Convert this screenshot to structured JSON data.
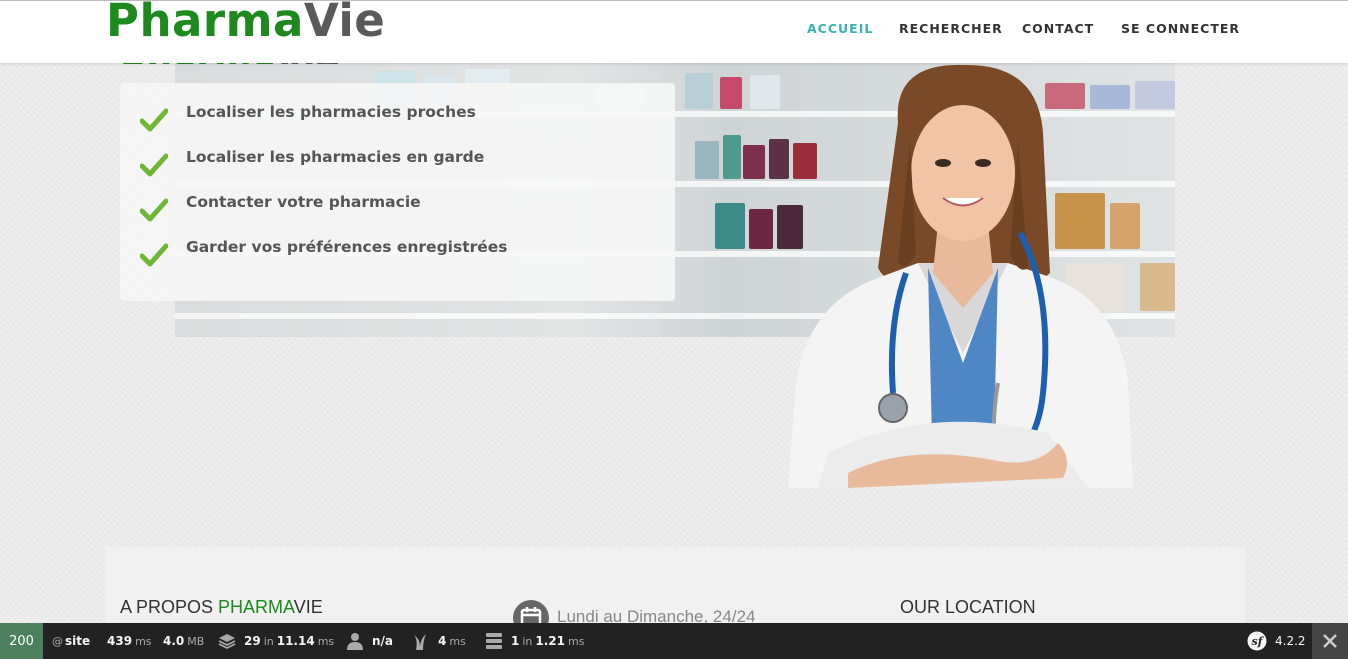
{
  "header": {
    "logo": {
      "part1": "Pharma",
      "part2": "Vie"
    },
    "nav": [
      {
        "label": "ACCUEIL",
        "active": true
      },
      {
        "label": "RECHERCHER",
        "active": false
      },
      {
        "label": "CONTACT",
        "active": false
      },
      {
        "label": "SE CONNECTER",
        "active": false
      }
    ]
  },
  "hero": {
    "logo": {
      "part1": "Pharma",
      "part2": "Vie"
    },
    "features": [
      "Localiser les pharmacies proches",
      "Localiser les pharmacies en garde",
      "Contacter votre pharmacie",
      "Garder vos préférences enregistrées"
    ]
  },
  "about": {
    "title_prefix": "A PROPOS ",
    "title_brand": "PHARMA",
    "title_suffix": "VIE",
    "hours": "Lundi au Dimanche, 24/24",
    "location_title": "OUR LOCATION"
  },
  "toolbar": {
    "status": "200",
    "route": "site",
    "time": {
      "value": "439",
      "unit": "ms"
    },
    "memory": {
      "value": "4.0",
      "unit": "MB"
    },
    "cache": {
      "value": "29",
      "sep": "in",
      "time": "11.14",
      "unit": "ms"
    },
    "user": "n/a",
    "twig": {
      "value": "4",
      "unit": "ms"
    },
    "db": {
      "value": "1",
      "sep": "in",
      "time": "1.21",
      "unit": "ms"
    },
    "version": "4.2.2"
  },
  "colors": {
    "brand_green": "#1c8a1c",
    "brand_gray": "#5a5a5a",
    "nav_active": "#3bb0b0",
    "check_green": "#6fb536",
    "toolbar_bg": "#222222",
    "status_green": "#4f805d"
  }
}
